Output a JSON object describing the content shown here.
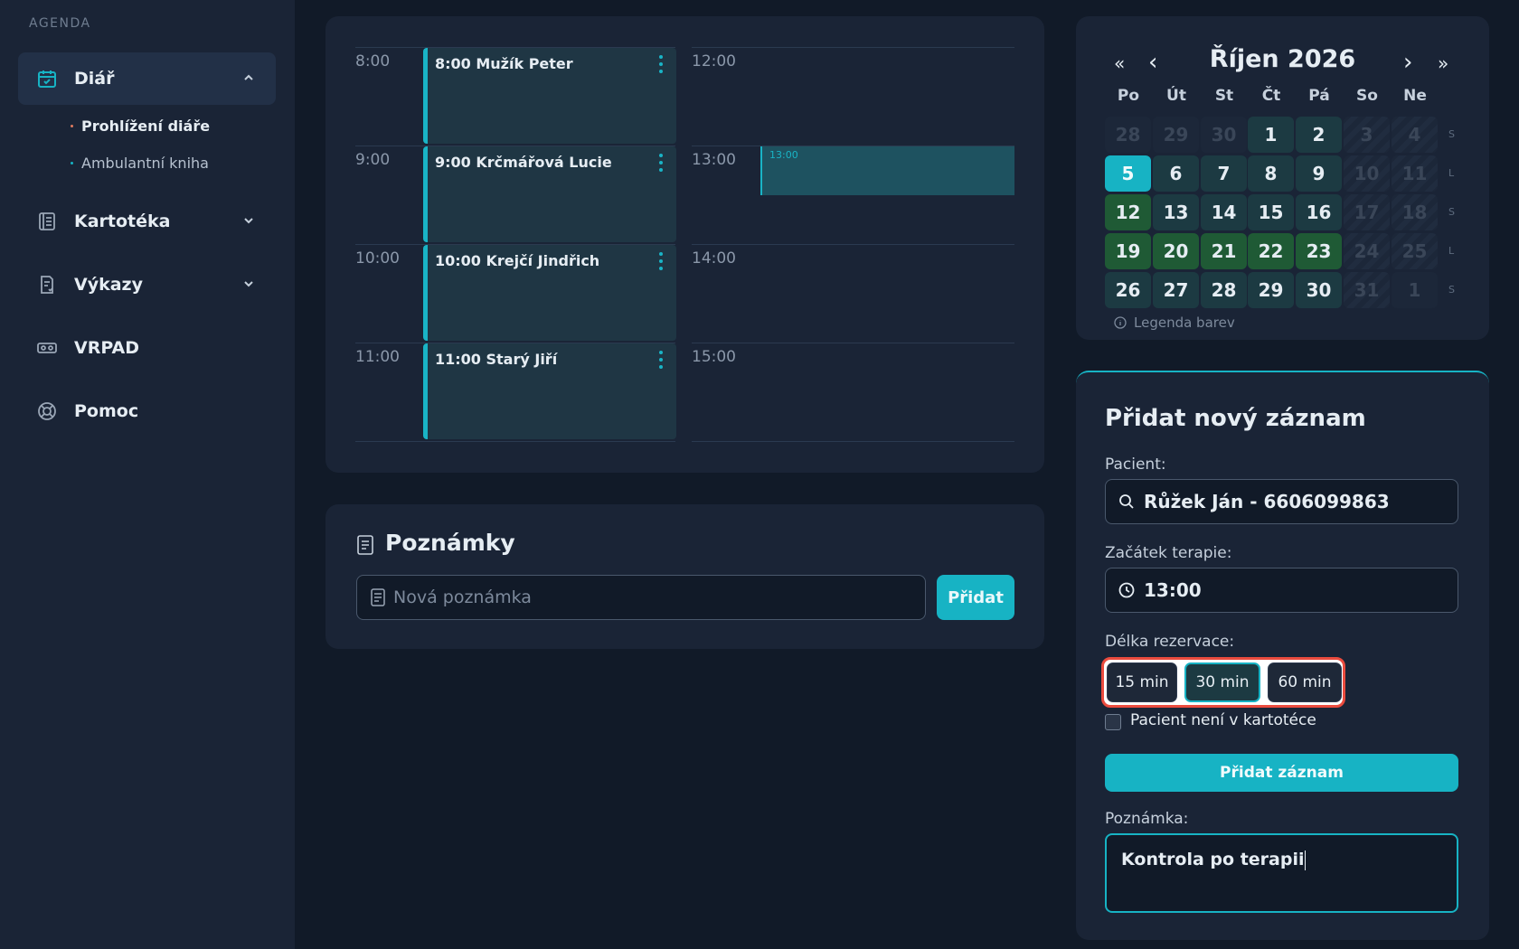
{
  "sidebar": {
    "section_label": "AGENDA",
    "items": [
      {
        "label": "Diář",
        "icon": "calendar-check-icon"
      },
      {
        "label": "Kartotéka",
        "icon": "card-file-icon"
      },
      {
        "label": "Výkazy",
        "icon": "report-icon"
      },
      {
        "label": "VRPAD",
        "icon": "vr-headset-icon"
      },
      {
        "label": "Pomoc",
        "icon": "lifebuoy-icon"
      }
    ],
    "sub_items": [
      {
        "label": "Prohlížení diáře"
      },
      {
        "label": "Ambulantní kniha"
      }
    ]
  },
  "schedule": {
    "times_left": [
      "8:00",
      "9:00",
      "10:00",
      "11:00"
    ],
    "times_right": [
      "12:00",
      "13:00",
      "14:00",
      "15:00"
    ],
    "appointments": [
      {
        "label": "8:00  Mužík Peter"
      },
      {
        "label": "9:00  Krčmářová Lucie"
      },
      {
        "label": "10:00  Krejčí Jindřich"
      },
      {
        "label": "11:00  Starý Jiří"
      }
    ],
    "new_slot_label": "13:00"
  },
  "notes": {
    "title": "Poznámky",
    "placeholder": "Nová poznámka",
    "add_label": "Přidat"
  },
  "calendar": {
    "prev_year": "«",
    "prev_month": "‹",
    "next_month": "›",
    "next_year": "»",
    "month_label": "Říjen 2026",
    "weekdays": [
      "Po",
      "Út",
      "St",
      "Čt",
      "Pá",
      "So",
      "Ne"
    ],
    "weeks": [
      {
        "days": [
          "28",
          "29",
          "30",
          "1",
          "2",
          "3",
          "4"
        ],
        "marker": "S"
      },
      {
        "days": [
          "5",
          "6",
          "7",
          "8",
          "9",
          "10",
          "11"
        ],
        "marker": "L"
      },
      {
        "days": [
          "12",
          "13",
          "14",
          "15",
          "16",
          "17",
          "18"
        ],
        "marker": "S"
      },
      {
        "days": [
          "19",
          "20",
          "21",
          "22",
          "23",
          "24",
          "25"
        ],
        "marker": "L"
      },
      {
        "days": [
          "26",
          "27",
          "28",
          "29",
          "30",
          "31",
          "1"
        ],
        "marker": "S"
      }
    ],
    "selected_day": "5",
    "legend_label": "Legenda barev",
    "colors": {
      "today": "#17b3c4",
      "teal": "#1c3a42",
      "green": "#1f5a35"
    }
  },
  "form": {
    "title": "Přidat nový záznam",
    "patient_label": "Pacient:",
    "patient_value": "Růžek Ján - 6606099863",
    "start_label": "Začátek terapie:",
    "start_value": "13:00",
    "duration_label": "Délka rezervace:",
    "durations": [
      "15 min",
      "30 min",
      "60 min"
    ],
    "selected_duration": "30 min",
    "not_in_file_label": "Pacient není v kartotéce",
    "not_in_file_checked": false,
    "submit_label": "Přidat záznam",
    "note_label": "Poznámka:",
    "note_value": "Kontrola po terapii"
  },
  "accent": "#17b3c4"
}
